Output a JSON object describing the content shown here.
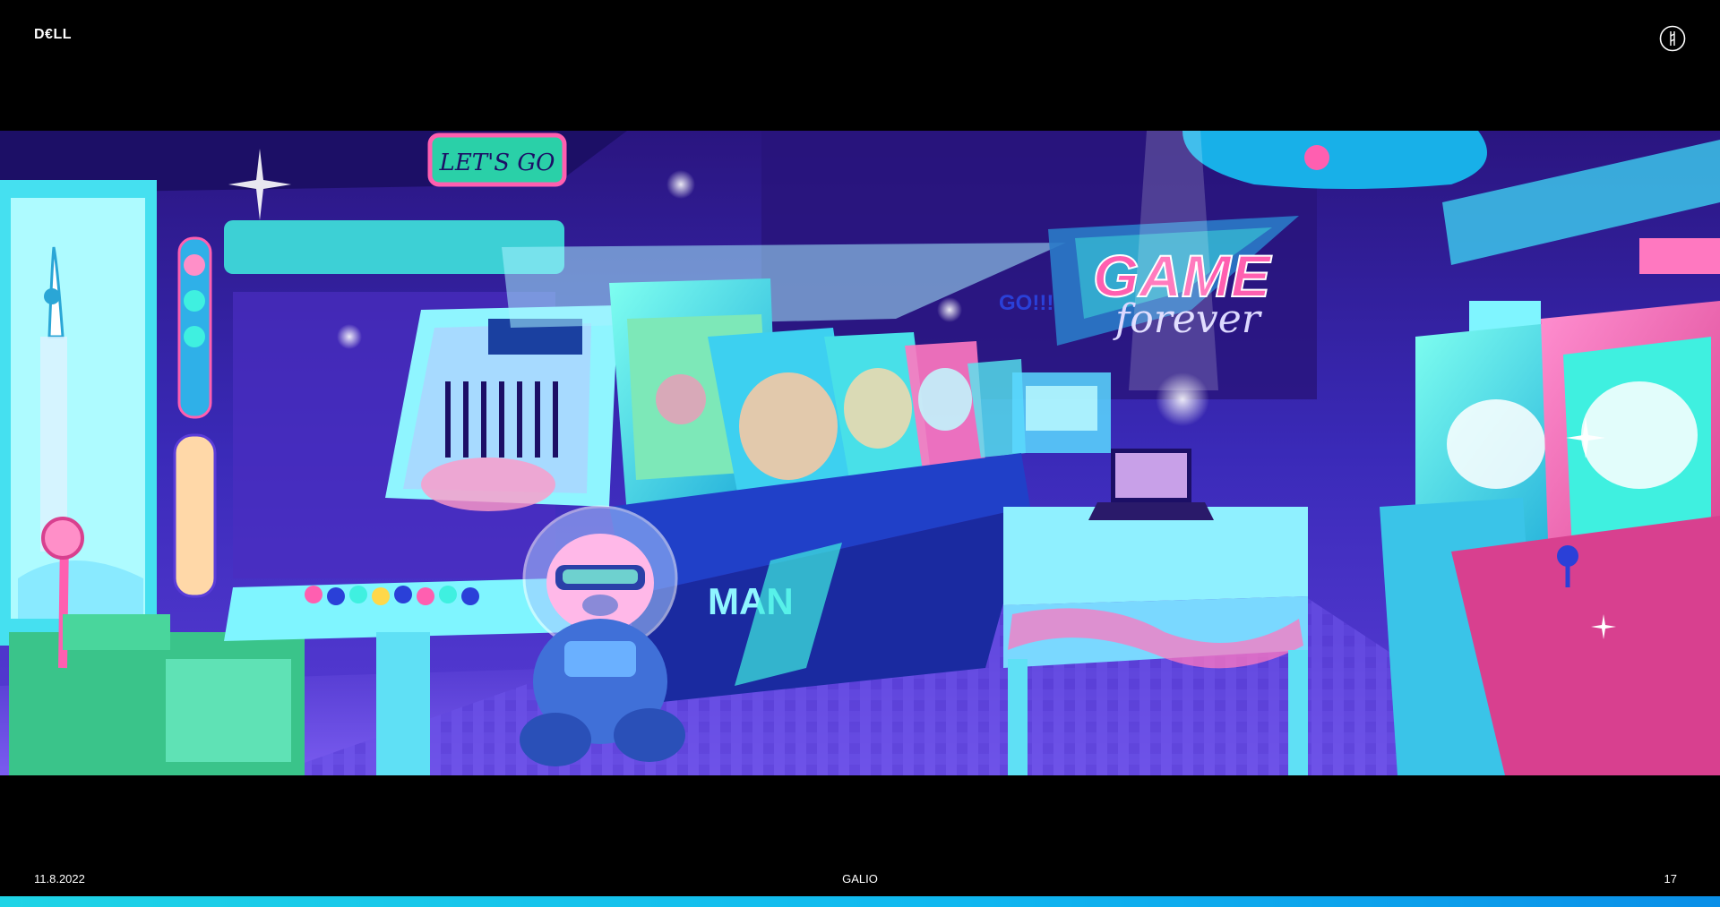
{
  "header": {
    "logo_text": "D€LL",
    "corner_icon": "circle-emblem-icon"
  },
  "hero": {
    "sign_main": "GAME",
    "sign_sub": "forever",
    "sign_go": "GO!!!",
    "sign_top": "LET'S GO",
    "cabinet_text": "MAN"
  },
  "footer": {
    "date": "11.8.2022",
    "center": "GALIO",
    "page_number": "17"
  },
  "colors": {
    "background": "#000000",
    "bottom_bar": "#1fd4e6",
    "neon_pink": "#ff5fb0",
    "neon_cyan": "#3ff0e0",
    "purple": "#5a3dd8"
  }
}
